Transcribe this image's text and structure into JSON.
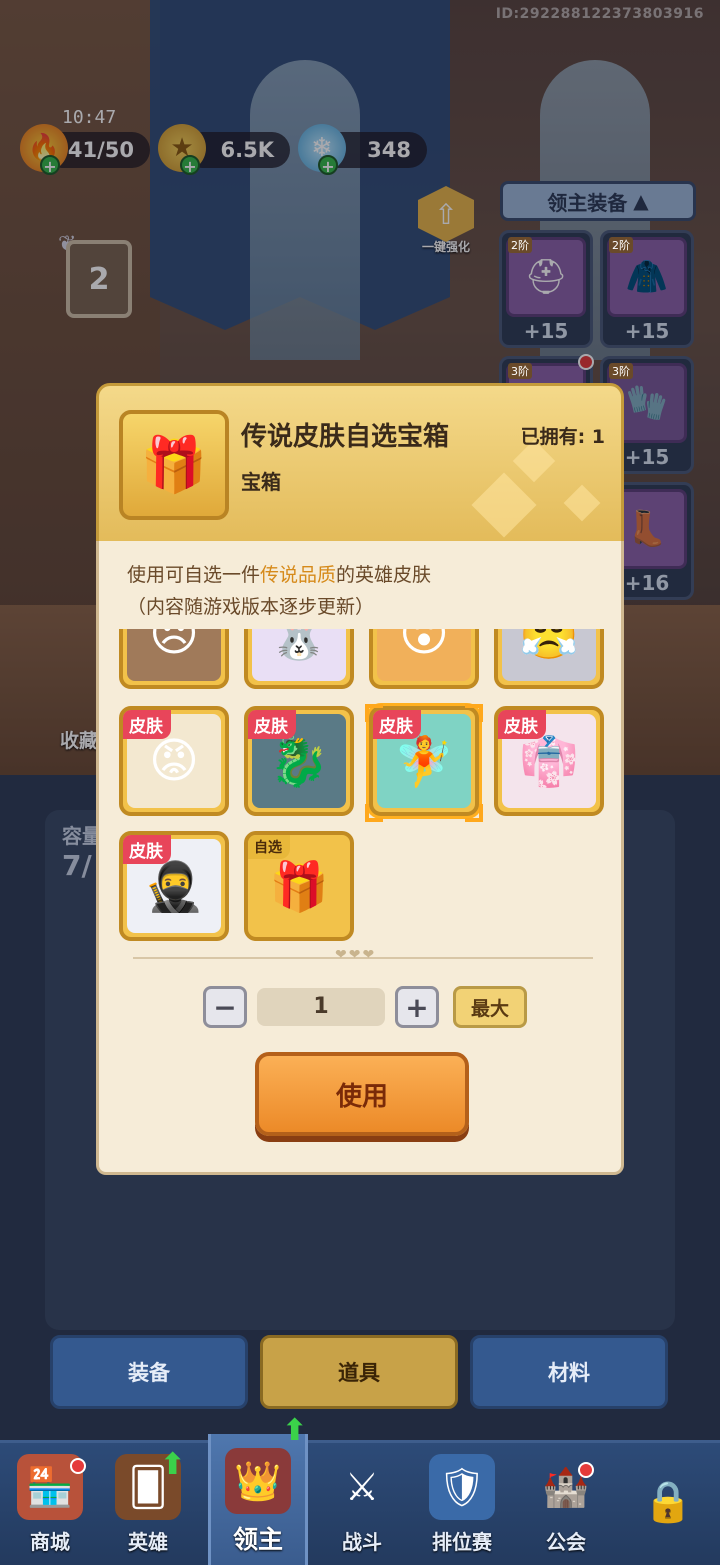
{
  "status": {
    "player_id": "ID:292288122373803916",
    "time": "10:47"
  },
  "resources": [
    {
      "name": "stamina",
      "icon": "flame-icon",
      "value": "41/50"
    },
    {
      "name": "gold",
      "icon": "coin-icon",
      "value": "6.5K"
    },
    {
      "name": "gems",
      "icon": "crystal-icon",
      "value": "348"
    }
  ],
  "lord": {
    "level": "2",
    "upgrade_label": "一键强化",
    "equipment_header": "领主装备"
  },
  "equipment_slots": [
    {
      "tier": "2阶",
      "bonus": "+15",
      "icon": "helmet-icon"
    },
    {
      "tier": "2阶",
      "bonus": "+15",
      "icon": "armor-icon"
    },
    {
      "tier": "3阶",
      "bonus": "",
      "icon": "weapon-icon"
    },
    {
      "tier": "3阶",
      "bonus": "+15",
      "icon": "gloves-icon"
    },
    {
      "tier": "",
      "bonus": "+16",
      "icon": "boots-icon"
    }
  ],
  "background_labels": {
    "collection": "收藏",
    "capacity_label": "容量",
    "capacity_value": "7/"
  },
  "modal": {
    "item_name": "传说皮肤自选宝箱",
    "item_type": "宝箱",
    "owned_label": "已拥有: 1",
    "desc_prefix": "使用可自选一件",
    "desc_highlight": "传说品质",
    "desc_suffix": "的英雄皮肤",
    "desc_line2": "（内容随游戏版本逐步更新）",
    "skin_tag": "皮肤",
    "select_tag": "自选",
    "quantity": "1",
    "max_label": "最大",
    "use_label": "使用",
    "minus_symbol": "−",
    "plus_symbol": "+"
  },
  "tabs": [
    {
      "label": "装备",
      "active": false
    },
    {
      "label": "道具",
      "active": true
    },
    {
      "label": "材料",
      "active": false
    }
  ],
  "nav": [
    {
      "label": "商城",
      "icon": "shop-icon"
    },
    {
      "label": "英雄",
      "icon": "hero-card-icon"
    },
    {
      "label": "领主",
      "icon": "lord-banner-icon",
      "active": true
    },
    {
      "label": "战斗",
      "icon": "crossed-swords-icon"
    },
    {
      "label": "排位赛",
      "icon": "rank-shield-icon"
    },
    {
      "label": "公会",
      "icon": "guild-castle-icon"
    }
  ],
  "colors": {
    "accent_gold": "#e3bb5a",
    "skin_tag_red": "#e8455a",
    "highlight_orange": "#d68a1a",
    "use_button": "#ec8a28",
    "nav_blue": "#2d4b78"
  }
}
